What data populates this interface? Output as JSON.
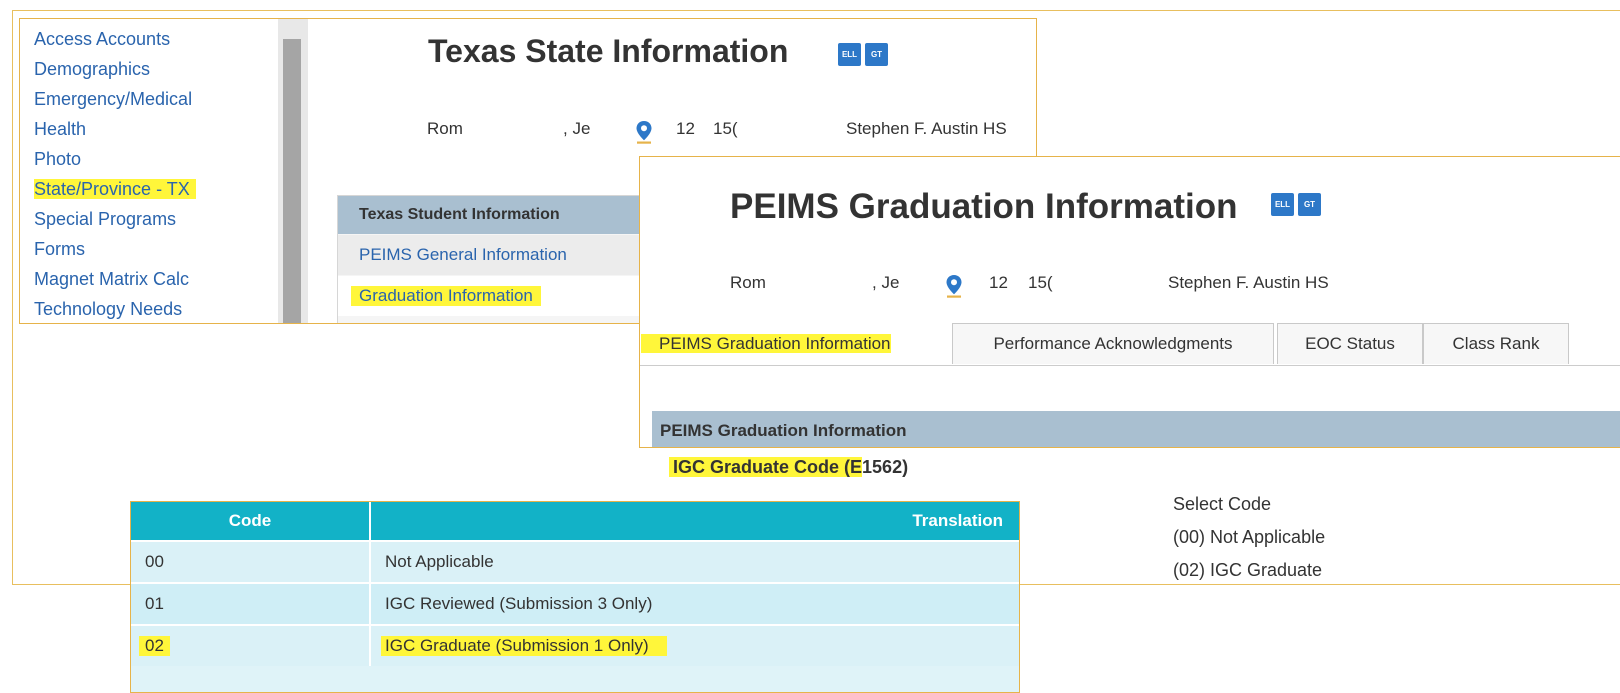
{
  "nav": {
    "items": [
      "Access Accounts",
      "Demographics",
      "Emergency/Medical",
      "Health",
      "Photo",
      "State/Province - TX",
      "Special Programs",
      "Forms",
      "Magnet Matrix Calc",
      "Technology Needs"
    ],
    "active_index": 5
  },
  "texas_panel": {
    "title": "Texas State Information",
    "badges": [
      "ELL",
      "GT"
    ],
    "student": {
      "last_name": "Rom",
      "first_name": ", Je",
      "grade": "12",
      "id": "15(",
      "school": "Stephen F. Austin HS"
    },
    "card_header": "Texas Student Information",
    "card_items": [
      "PEIMS General Information",
      "Graduation Information"
    ]
  },
  "peims_panel": {
    "title": "PEIMS Graduation Information",
    "badges": [
      "ELL",
      "GT"
    ],
    "student": {
      "last_name": "Rom",
      "first_name": ", Je",
      "grade": "12",
      "id": "15(",
      "school": "Stephen F. Austin HS"
    },
    "tabs": [
      "PEIMS Graduation Information",
      "Performance Acknowledgments",
      "EOC Status",
      "Class Rank"
    ],
    "active_tab_index": 0,
    "section_header": "PEIMS Graduation Information",
    "field_label_highlight": "IGC Graduate Code (E",
    "field_label_rest": "1562)",
    "select_options": [
      "Select Code",
      "(00) Not Applicable",
      "(02) IGC Graduate"
    ]
  },
  "code_table": {
    "headers": {
      "code": "Code",
      "translation": "Translation"
    },
    "rows": [
      {
        "code": "00",
        "translation": "Not Applicable"
      },
      {
        "code": "01",
        "translation": "IGC Reviewed (Submission 3 Only)"
      },
      {
        "code": "02",
        "translation": "IGC Graduate (Submission 1 Only)"
      }
    ],
    "highlighted_row_index": 2
  },
  "colors": {
    "highlight": "#fff63a",
    "frame": "#e6b34a",
    "link": "#2a64ad",
    "table_header": "#12b2c7",
    "section_header": "#a9bfd0",
    "badge": "#2d78c8"
  }
}
